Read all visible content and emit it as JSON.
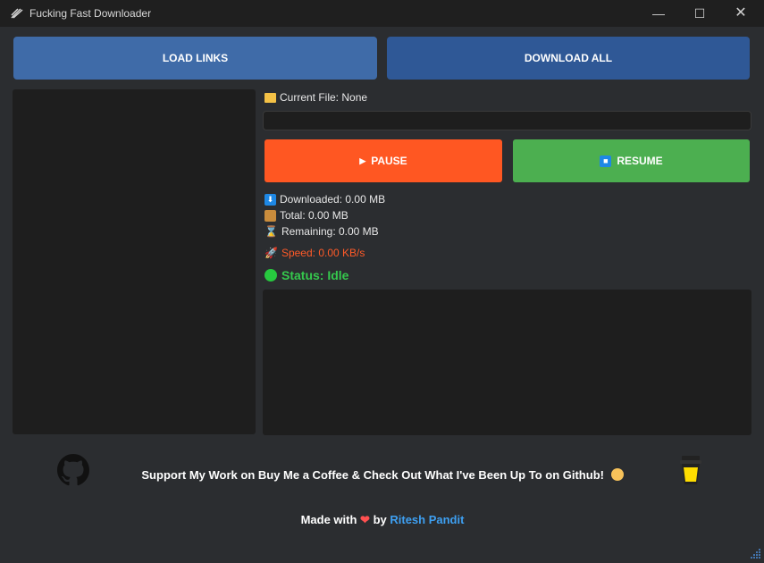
{
  "window": {
    "title": "Fucking Fast Downloader"
  },
  "toolbar": {
    "load_links": "LOAD LINKS",
    "download_all": "DOWNLOAD ALL"
  },
  "current_file": {
    "label": "Current File: None"
  },
  "controls": {
    "pause": "PAUSE",
    "resume": "RESUME"
  },
  "stats": {
    "downloaded": "Downloaded: 0.00 MB",
    "total": "Total: 0.00 MB",
    "remaining": "Remaining: 0.00 MB",
    "speed": "Speed: 0.00 KB/s",
    "status": "Status: Idle"
  },
  "footer": {
    "support": "Support My Work on Buy Me a Coffee & Check Out What I've Been Up To on Github!",
    "made_with": "Made with",
    "by": "by",
    "author": "Ritesh Pandit"
  },
  "colors": {
    "load_btn": "#3f6ba8",
    "download_btn": "#2f5896",
    "pause_btn": "#ff5722",
    "resume_btn": "#4caf50",
    "speed": "#ff5a28",
    "status": "#35c94d"
  }
}
